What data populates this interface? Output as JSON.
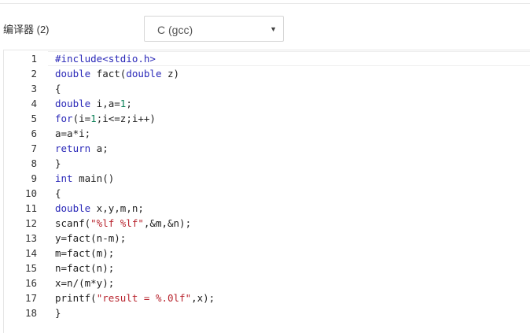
{
  "compiler": {
    "label": "编译器 (2)",
    "selected": "C (gcc)",
    "caret": "▼"
  },
  "editor": {
    "lines": [
      {
        "n": "1",
        "parts": [
          {
            "t": "#include<stdio.h>",
            "c": "kw"
          }
        ]
      },
      {
        "n": "2",
        "parts": [
          {
            "t": "double",
            "c": "kw"
          },
          {
            "t": " fact(",
            "c": "plain"
          },
          {
            "t": "double",
            "c": "kw"
          },
          {
            "t": " z)",
            "c": "plain"
          }
        ]
      },
      {
        "n": "3",
        "parts": [
          {
            "t": "{",
            "c": "plain"
          }
        ]
      },
      {
        "n": "4",
        "parts": [
          {
            "t": "double",
            "c": "kw"
          },
          {
            "t": " i,a=",
            "c": "plain"
          },
          {
            "t": "1",
            "c": "num"
          },
          {
            "t": ";",
            "c": "plain"
          }
        ]
      },
      {
        "n": "5",
        "parts": [
          {
            "t": "for",
            "c": "kw"
          },
          {
            "t": "(i=",
            "c": "plain"
          },
          {
            "t": "1",
            "c": "num"
          },
          {
            "t": ";i<=z;i++)",
            "c": "plain"
          }
        ]
      },
      {
        "n": "6",
        "parts": [
          {
            "t": "a=a*i;",
            "c": "plain"
          }
        ]
      },
      {
        "n": "7",
        "parts": [
          {
            "t": "return",
            "c": "kw"
          },
          {
            "t": " a;",
            "c": "plain"
          }
        ]
      },
      {
        "n": "8",
        "parts": [
          {
            "t": "}",
            "c": "plain"
          }
        ]
      },
      {
        "n": "9",
        "parts": [
          {
            "t": "int",
            "c": "kw"
          },
          {
            "t": " main()",
            "c": "plain"
          }
        ]
      },
      {
        "n": "10",
        "parts": [
          {
            "t": "{",
            "c": "plain"
          }
        ]
      },
      {
        "n": "11",
        "parts": [
          {
            "t": "double",
            "c": "kw"
          },
          {
            "t": " x,y,m,n;",
            "c": "plain"
          }
        ]
      },
      {
        "n": "12",
        "parts": [
          {
            "t": "scanf(",
            "c": "plain"
          },
          {
            "t": "\"%lf %lf\"",
            "c": "str"
          },
          {
            "t": ",&m,&n);",
            "c": "plain"
          }
        ]
      },
      {
        "n": "13",
        "parts": [
          {
            "t": "y=fact(n-m);",
            "c": "plain"
          }
        ]
      },
      {
        "n": "14",
        "parts": [
          {
            "t": "m=fact(m);",
            "c": "plain"
          }
        ]
      },
      {
        "n": "15",
        "parts": [
          {
            "t": "n=fact(n);",
            "c": "plain"
          }
        ]
      },
      {
        "n": "16",
        "parts": [
          {
            "t": "x=n/(m*y);",
            "c": "plain"
          }
        ]
      },
      {
        "n": "17",
        "parts": [
          {
            "t": "printf(",
            "c": "plain"
          },
          {
            "t": "\"result = %.0lf\"",
            "c": "str"
          },
          {
            "t": ",x);",
            "c": "plain"
          }
        ]
      },
      {
        "n": "18",
        "parts": [
          {
            "t": "}",
            "c": "plain"
          }
        ]
      }
    ]
  }
}
